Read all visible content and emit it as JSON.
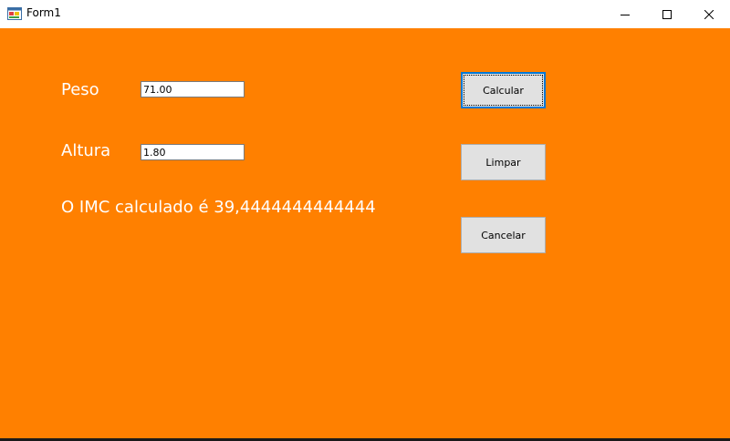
{
  "window": {
    "title": "Form1",
    "icon": "winforms-app-icon",
    "controls": [
      "minimize-icon",
      "maximize-icon",
      "close-icon"
    ]
  },
  "form": {
    "background_color": "#ff8000",
    "label_color": "#ffffff",
    "peso_label": "Peso",
    "peso_value": "71.00",
    "altura_label": "Altura",
    "altura_value": "1.80",
    "result_text": "O IMC calculado é 39,4444444444444"
  },
  "buttons": {
    "calcular": "Calcular",
    "limpar": "Limpar",
    "cancelar": "Cancelar"
  }
}
